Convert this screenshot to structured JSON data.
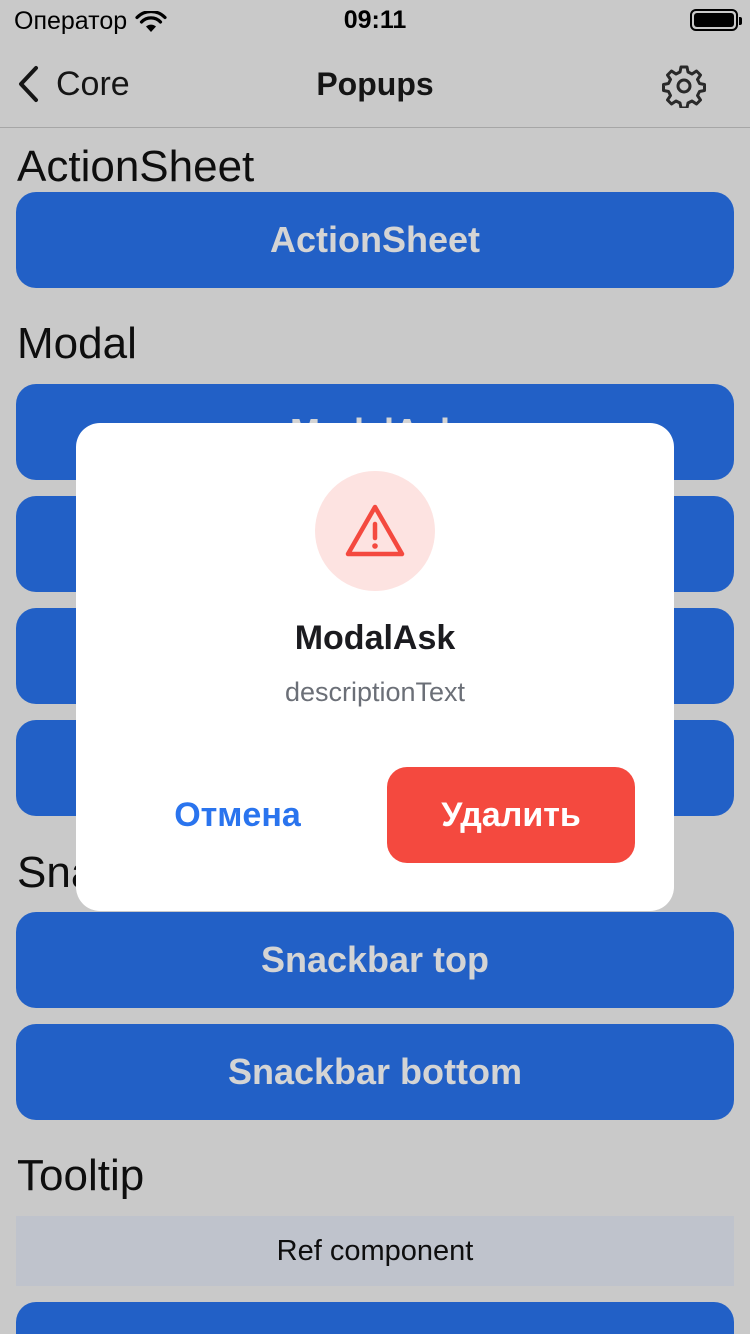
{
  "status_bar": {
    "carrier": "Оператор",
    "time": "09:11"
  },
  "nav": {
    "back_label": "Core",
    "title": "Popups",
    "settings_icon": "gear-icon"
  },
  "sections": {
    "action_sheet": {
      "title": "ActionSheet",
      "buttons": [
        "ActionSheet"
      ]
    },
    "modal": {
      "title": "Modal",
      "buttons": [
        "ModalAsk",
        "",
        "",
        ""
      ]
    },
    "snackbar": {
      "title": "Snackbar",
      "buttons": [
        "Snackbar top",
        "Snackbar bottom"
      ]
    },
    "tooltip": {
      "title": "Tooltip",
      "ref_component": "Ref component"
    }
  },
  "modal_dialog": {
    "icon": "warning-triangle-icon",
    "title": "ModalAsk",
    "description": "descriptionText",
    "cancel_label": "Отмена",
    "delete_label": "Удалить"
  },
  "colors": {
    "primary": "#2a74ee",
    "danger": "#f4493f",
    "danger_soft": "#fde3e1",
    "overlay": "rgba(0,0,0,0.17)"
  }
}
